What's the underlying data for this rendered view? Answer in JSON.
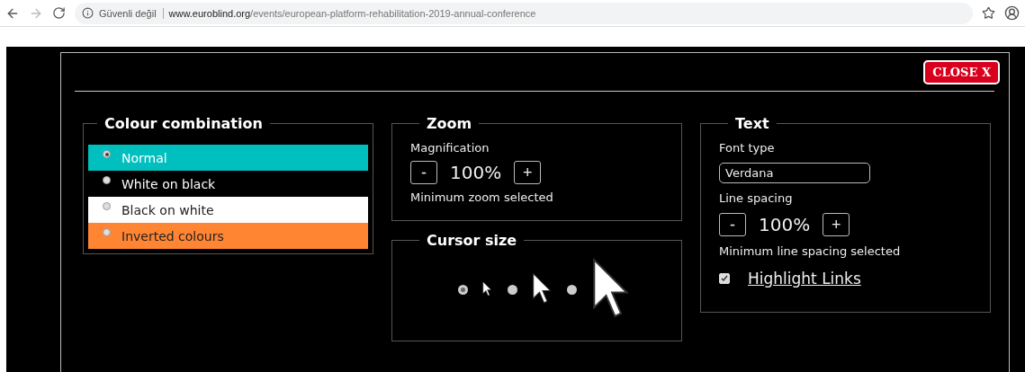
{
  "browser": {
    "security_label": "Güvenli değil",
    "url_host": "www.euroblind.org",
    "url_path": "/events/european-platform-rehabilitation-2019-annual-conference"
  },
  "dialog": {
    "close_button": "CLOSE X",
    "colour_combination": {
      "title": "Colour combination",
      "options": [
        {
          "label": "Normal",
          "selected": true,
          "color": "#00bfbf"
        },
        {
          "label": "White on black",
          "selected": false,
          "color": "#000000"
        },
        {
          "label": "Black on white",
          "selected": false,
          "color": "#ffffff"
        },
        {
          "label": "Inverted colours",
          "selected": false,
          "color": "#ff8533"
        }
      ]
    },
    "zoom": {
      "title": "Zoom",
      "label": "Magnification",
      "minus": "-",
      "value": "100%",
      "plus": "+",
      "note": "Minimum zoom selected"
    },
    "cursor_size": {
      "title": "Cursor size",
      "options": [
        {
          "selected": true
        },
        {
          "selected": false
        },
        {
          "selected": false
        }
      ]
    },
    "text": {
      "title": "Text",
      "font_label": "Font type",
      "font_value": "Verdana",
      "spacing_label": "Line spacing",
      "minus": "-",
      "value": "100%",
      "plus": "+",
      "note": "Minimum line spacing selected",
      "highlight_links": {
        "label": "Highlight Links",
        "checked": true
      }
    }
  }
}
